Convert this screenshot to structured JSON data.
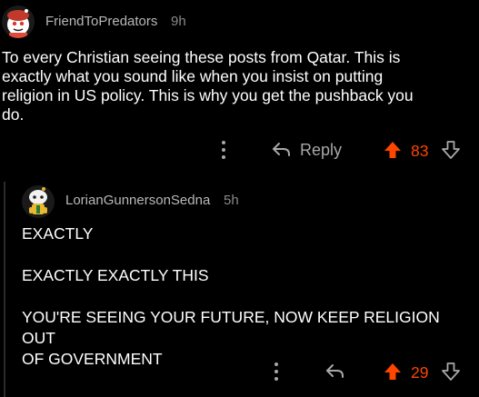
{
  "colors": {
    "background": "#000000",
    "upvote": "#ff4500",
    "muted": "#a8a8ab"
  },
  "comment1": {
    "username": "FriendToPredators",
    "age": "9h",
    "body": [
      "To every Christian seeing these posts from Qatar. This is",
      "exactly what you sound like when you insist on putting",
      "religion in US policy. This is why you get the pushback you",
      "do."
    ],
    "actions": {
      "more_icon": "vertical-ellipsis-icon",
      "reply_icon": "reply-arrow-icon",
      "reply_label": "Reply",
      "upvote_icon": "upvote-arrow-icon",
      "score": "83",
      "downvote_icon": "downvote-arrow-icon"
    }
  },
  "comment2": {
    "username": "LorianGunnersonSedna",
    "age": "5h",
    "body": [
      "EXACTLY",
      "",
      "EXACTLY EXACTLY THIS",
      "",
      "YOU'RE SEEING YOUR FUTURE, NOW KEEP RELIGION OUT",
      "OF GOVERNMENT"
    ],
    "actions": {
      "more_icon": "vertical-ellipsis-icon",
      "reply_icon": "reply-arrow-icon",
      "upvote_icon": "upvote-arrow-icon",
      "score": "29",
      "downvote_icon": "downvote-arrow-icon"
    }
  }
}
